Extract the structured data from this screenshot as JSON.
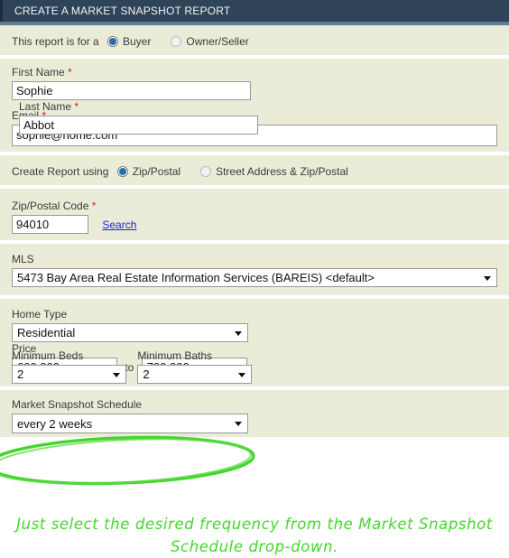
{
  "header": {
    "title": "CREATE A MARKET SNAPSHOT REPORT"
  },
  "report_for": {
    "lead_label": "This report is for a",
    "options": [
      {
        "label": "Buyer",
        "selected": true
      },
      {
        "label": "Owner/Seller",
        "selected": false
      }
    ]
  },
  "name_section": {
    "first_name_label": "First Name",
    "first_name_value": "Sophie",
    "last_name_label": "Last Name",
    "last_name_value": "Abbot",
    "email_label": "Email",
    "email_value": "sophie@home.com",
    "required_marker": "*"
  },
  "create_using": {
    "lead_label": "Create Report using",
    "options": [
      {
        "label": "Zip/Postal",
        "selected": true
      },
      {
        "label": "Street Address & Zip/Postal",
        "selected": false
      }
    ]
  },
  "zip_section": {
    "label": "Zip/Postal Code",
    "value": "94010",
    "search_link": "Search"
  },
  "mls_section": {
    "label": "MLS",
    "value": "5473 Bay Area Real Estate Information Services (BAREIS) <default>"
  },
  "criteria_section": {
    "home_type_label": "Home Type",
    "home_type_value": "Residential",
    "price_label": "Price",
    "price_min_value": "600,000",
    "price_to_word": "to",
    "price_max_value": "700,000",
    "min_beds_label": "Minimum Beds",
    "min_beds_value": "2",
    "min_baths_label": "Minimum Baths",
    "min_baths_value": "2"
  },
  "schedule_section": {
    "label": "Market Snapshot Schedule",
    "value": "every 2 weeks"
  },
  "annotation": {
    "line1": "Just select the desired frequency from the Market Snapshot",
    "line2": "Schedule drop-down.",
    "color": "#44d62c",
    "highlight_shape": "ellipse"
  },
  "colors": {
    "title_bar": "#2f4359",
    "title_underline": "#607c96",
    "section_bg": "#eaecd8",
    "required": "#cc2222",
    "link": "#2222cc",
    "radio_selected": "#2a6ca8",
    "annotation_green": "#44d62c"
  }
}
